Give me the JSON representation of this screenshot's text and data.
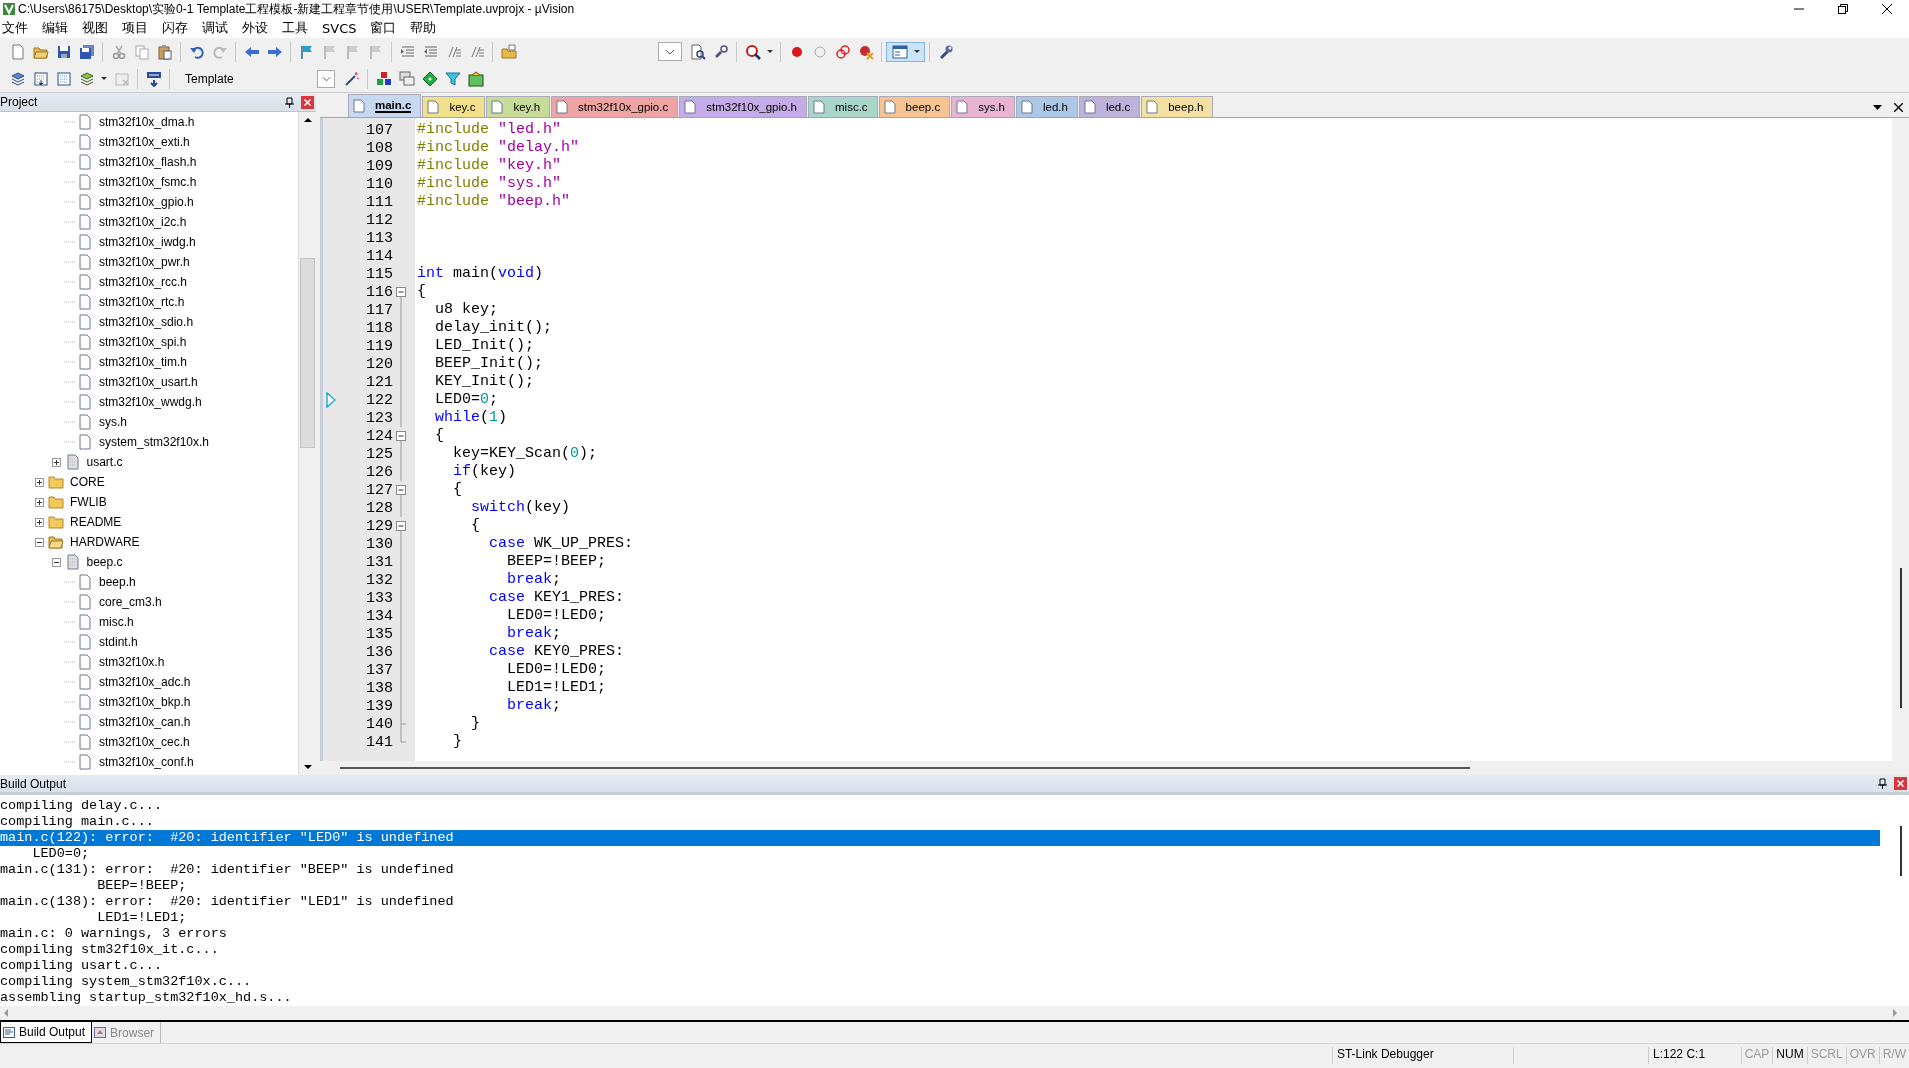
{
  "window": {
    "title": "C:\\Users\\86175\\Desktop\\实验0-1 Template工程模板-新建工程章节使用\\USER\\Template.uvprojx - µVision"
  },
  "menu": [
    "文件",
    "编辑",
    "视图",
    "项目",
    "闪存",
    "调试",
    "外设",
    "工具",
    "SVCS",
    "窗口",
    "帮助"
  ],
  "target_select": {
    "value": "Template"
  },
  "project_panel": {
    "title": "Project",
    "tree": [
      {
        "children": [
          {
            "children": [
              {
                "label": "stm32f10x_dma.h",
                "kind": "header"
              },
              {
                "label": "stm32f10x_exti.h",
                "kind": "header"
              },
              {
                "label": "stm32f10x_flash.h",
                "kind": "header"
              },
              {
                "label": "stm32f10x_fsmc.h",
                "kind": "header"
              },
              {
                "label": "stm32f10x_gpio.h",
                "kind": "header"
              },
              {
                "label": "stm32f10x_i2c.h",
                "kind": "header"
              },
              {
                "label": "stm32f10x_iwdg.h",
                "kind": "header"
              },
              {
                "label": "stm32f10x_pwr.h",
                "kind": "header"
              },
              {
                "label": "stm32f10x_rcc.h",
                "kind": "header"
              },
              {
                "label": "stm32f10x_rtc.h",
                "kind": "header"
              },
              {
                "label": "stm32f10x_sdio.h",
                "kind": "header"
              },
              {
                "label": "stm32f10x_spi.h",
                "kind": "header"
              },
              {
                "label": "stm32f10x_tim.h",
                "kind": "header"
              },
              {
                "label": "stm32f10x_usart.h",
                "kind": "header"
              },
              {
                "label": "stm32f10x_wwdg.h",
                "kind": "header"
              },
              {
                "label": "sys.h",
                "kind": "header"
              },
              {
                "label": "system_stm32f10x.h",
                "kind": "header"
              }
            ]
          },
          {
            "label": "usart.c",
            "kind": "source",
            "expanded": false
          }
        ]
      },
      {
        "label": "CORE",
        "kind": "folder",
        "expanded": false
      },
      {
        "label": "FWLIB",
        "kind": "folder",
        "expanded": false
      },
      {
        "label": "README",
        "kind": "folder",
        "expanded": false
      },
      {
        "label": "HARDWARE",
        "kind": "folder",
        "expanded": true,
        "children": [
          {
            "label": "beep.c",
            "kind": "source",
            "expanded": true,
            "children": [
              {
                "label": "beep.h",
                "kind": "header"
              },
              {
                "label": "core_cm3.h",
                "kind": "header"
              },
              {
                "label": "misc.h",
                "kind": "header"
              },
              {
                "label": "stdint.h",
                "kind": "header"
              },
              {
                "label": "stm32f10x.h",
                "kind": "header"
              },
              {
                "label": "stm32f10x_adc.h",
                "kind": "header"
              },
              {
                "label": "stm32f10x_bkp.h",
                "kind": "header"
              },
              {
                "label": "stm32f10x_can.h",
                "kind": "header"
              },
              {
                "label": "stm32f10x_cec.h",
                "kind": "header"
              },
              {
                "label": "stm32f10x_conf.h",
                "kind": "header"
              }
            ]
          }
        ]
      }
    ]
  },
  "editor_tabs": [
    {
      "label": "main.c",
      "selected": true,
      "color": "#c8d8f0"
    },
    {
      "label": "key.c",
      "selected": false,
      "color": "#f2e08a"
    },
    {
      "label": "key.h",
      "selected": false,
      "color": "#c6dc98"
    },
    {
      "label": "stm32f10x_gpio.c",
      "selected": false,
      "color": "#eea4a4"
    },
    {
      "label": "stm32f10x_gpio.h",
      "selected": false,
      "color": "#c4ace8"
    },
    {
      "label": "misc.c",
      "selected": false,
      "color": "#a8d6c8"
    },
    {
      "label": "beep.c",
      "selected": false,
      "color": "#f5c492"
    },
    {
      "label": "sys.h",
      "selected": false,
      "color": "#e8b4d2"
    },
    {
      "label": "led.h",
      "selected": false,
      "color": "#acc8e6"
    },
    {
      "label": "led.c",
      "selected": false,
      "color": "#bcb2da"
    },
    {
      "label": "beep.h",
      "selected": false,
      "color": "#f5e0a4"
    }
  ],
  "code": [
    {
      "number": "107",
      "kind": "plain",
      "marker": false,
      "segments": [
        {
          "kind": "preproc",
          "text": "#include"
        },
        {
          "kind": "string",
          "text": " \"led.h\""
        }
      ]
    },
    {
      "number": "108",
      "kind": "plain",
      "marker": false,
      "segments": [
        {
          "kind": "preproc",
          "text": "#include"
        },
        {
          "kind": "string",
          "text": " \"delay.h\""
        }
      ]
    },
    {
      "number": "109",
      "kind": "plain",
      "marker": false,
      "segments": [
        {
          "kind": "preproc",
          "text": "#include"
        },
        {
          "kind": "string",
          "text": " \"key.h\""
        }
      ]
    },
    {
      "number": "110",
      "kind": "plain",
      "marker": false,
      "segments": [
        {
          "kind": "preproc",
          "text": "#include"
        },
        {
          "kind": "string",
          "text": " \"sys.h\""
        }
      ]
    },
    {
      "number": "111",
      "kind": "plain",
      "marker": false,
      "segments": [
        {
          "kind": "preproc",
          "text": "#include"
        },
        {
          "kind": "string",
          "text": " \"beep.h\""
        }
      ]
    },
    {
      "number": "112",
      "kind": "plain",
      "marker": false
    },
    {
      "number": "113",
      "kind": "plain",
      "marker": false
    },
    {
      "number": "114",
      "kind": "plain",
      "marker": false
    },
    {
      "number": "115",
      "kind": "plain",
      "marker": false,
      "segments": [
        {
          "kind": "keyword",
          "text": "int"
        },
        {
          "kind": "plain",
          "text": " main("
        },
        {
          "kind": "keyword",
          "text": "void"
        },
        {
          "kind": "plain",
          "text": ")"
        }
      ]
    },
    {
      "number": "116",
      "kind": "fold_start",
      "marker": false,
      "segments": [
        {
          "kind": "plain",
          "text": "{"
        }
      ]
    },
    {
      "number": "117",
      "kind": "fold_body",
      "marker": false,
      "segments": [
        {
          "kind": "plain",
          "text": "  u8 key;"
        }
      ]
    },
    {
      "number": "118",
      "kind": "fold_body",
      "marker": false,
      "segments": [
        {
          "kind": "plain",
          "text": "  delay_init();"
        }
      ]
    },
    {
      "number": "119",
      "kind": "fold_body",
      "marker": false,
      "segments": [
        {
          "kind": "plain",
          "text": "  LED_Init();"
        }
      ]
    },
    {
      "number": "120",
      "kind": "fold_body",
      "marker": false,
      "segments": [
        {
          "kind": "plain",
          "text": "  BEEP_Init();"
        }
      ]
    },
    {
      "number": "121",
      "kind": "fold_body",
      "marker": false,
      "segments": [
        {
          "kind": "plain",
          "text": "  KEY_Init();"
        }
      ]
    },
    {
      "number": "122",
      "kind": "fold_body",
      "marker": true,
      "segments": [
        {
          "kind": "plain",
          "text": "  LED0="
        },
        {
          "kind": "number",
          "text": "0"
        },
        {
          "kind": "plain",
          "text": ";"
        }
      ]
    },
    {
      "number": "123",
      "kind": "fold_body",
      "marker": false,
      "segments": [
        {
          "kind": "keyword",
          "text": "  while"
        },
        {
          "kind": "plain",
          "text": "("
        },
        {
          "kind": "number",
          "text": "1"
        },
        {
          "kind": "plain",
          "text": ")"
        }
      ]
    },
    {
      "number": "124",
      "kind": "fold_start",
      "marker": false,
      "segments": [
        {
          "kind": "plain",
          "text": "  {"
        }
      ]
    },
    {
      "number": "125",
      "kind": "fold_body",
      "marker": false,
      "segments": [
        {
          "kind": "plain",
          "text": "    key=KEY_Scan("
        },
        {
          "kind": "number",
          "text": "0"
        },
        {
          "kind": "plain",
          "text": ");"
        }
      ]
    },
    {
      "number": "126",
      "kind": "fold_body",
      "marker": false,
      "segments": [
        {
          "kind": "keyword",
          "text": "    if"
        },
        {
          "kind": "plain",
          "text": "(key)"
        }
      ]
    },
    {
      "number": "127",
      "kind": "fold_start",
      "marker": false,
      "segments": [
        {
          "kind": "plain",
          "text": "    {"
        }
      ]
    },
    {
      "number": "128",
      "kind": "fold_body",
      "marker": false,
      "segments": [
        {
          "kind": "keyword",
          "text": "      switch"
        },
        {
          "kind": "plain",
          "text": "(key)"
        }
      ]
    },
    {
      "number": "129",
      "kind": "fold_start",
      "marker": false,
      "segments": [
        {
          "kind": "plain",
          "text": "      {"
        }
      ]
    },
    {
      "number": "130",
      "kind": "fold_body",
      "marker": false,
      "segments": [
        {
          "kind": "keyword",
          "text": "        case"
        },
        {
          "kind": "plain",
          "text": " WK_UP_PRES:"
        }
      ]
    },
    {
      "number": "131",
      "kind": "fold_body",
      "marker": false,
      "segments": [
        {
          "kind": "plain",
          "text": "          BEEP=!BEEP;"
        }
      ]
    },
    {
      "number": "132",
      "kind": "fold_body",
      "marker": false,
      "segments": [
        {
          "kind": "keyword",
          "text": "          break"
        },
        {
          "kind": "plain",
          "text": ";"
        }
      ]
    },
    {
      "number": "133",
      "kind": "fold_body",
      "marker": false,
      "segments": [
        {
          "kind": "keyword",
          "text": "        case"
        },
        {
          "kind": "plain",
          "text": " KEY1_PRES:"
        }
      ]
    },
    {
      "number": "134",
      "kind": "fold_body",
      "marker": false,
      "segments": [
        {
          "kind": "plain",
          "text": "          LED0=!LED0;"
        }
      ]
    },
    {
      "number": "135",
      "kind": "fold_body",
      "marker": false,
      "segments": [
        {
          "kind": "keyword",
          "text": "          break"
        },
        {
          "kind": "plain",
          "text": ";"
        }
      ]
    },
    {
      "number": "136",
      "kind": "fold_body",
      "marker": false,
      "segments": [
        {
          "kind": "keyword",
          "text": "        case"
        },
        {
          "kind": "plain",
          "text": " KEY0_PRES:"
        }
      ]
    },
    {
      "number": "137",
      "kind": "fold_body",
      "marker": false,
      "segments": [
        {
          "kind": "plain",
          "text": "          LED0=!LED0;"
        }
      ]
    },
    {
      "number": "138",
      "kind": "fold_body",
      "marker": false,
      "segments": [
        {
          "kind": "plain",
          "text": "          LED1=!LED1;"
        }
      ]
    },
    {
      "number": "139",
      "kind": "fold_body",
      "marker": false,
      "segments": [
        {
          "kind": "keyword",
          "text": "          break"
        },
        {
          "kind": "plain",
          "text": ";"
        }
      ]
    },
    {
      "number": "140",
      "kind": "fold_end",
      "marker": false,
      "segments": [
        {
          "kind": "plain",
          "text": "      }"
        }
      ]
    },
    {
      "number": "141",
      "kind": "fold_end",
      "marker": false,
      "segments": [
        {
          "kind": "plain",
          "text": "    }"
        }
      ]
    }
  ],
  "build_output": {
    "title": "Build Output",
    "lines": [
      {
        "text": "compiling delay.c...",
        "selected": false
      },
      {
        "text": "compiling main.c...",
        "selected": false
      },
      {
        "text": "main.c(122): error:  #20: identifier \"LED0\" is undefined",
        "selected": true
      },
      {
        "text": "    LED0=0;",
        "selected": false
      },
      {
        "text": "main.c(131): error:  #20: identifier \"BEEP\" is undefined",
        "selected": false
      },
      {
        "text": "            BEEP=!BEEP;",
        "selected": false
      },
      {
        "text": "main.c(138): error:  #20: identifier \"LED1\" is undefined",
        "selected": false
      },
      {
        "text": "            LED1=!LED1;",
        "selected": false
      },
      {
        "text": "main.c: 0 warnings, 3 errors",
        "selected": false
      },
      {
        "text": "compiling stm32f10x_it.c...",
        "selected": false
      },
      {
        "text": "compiling usart.c...",
        "selected": false
      },
      {
        "text": "compiling system_stm32f10x.c...",
        "selected": false
      },
      {
        "text": "assembling startup_stm32f10x_hd.s...",
        "selected": false
      }
    ],
    "tabs": [
      {
        "label": "Build Output",
        "selected": true
      },
      {
        "label": "Browser",
        "selected": false
      }
    ]
  },
  "status_bar": {
    "debugger": "ST-Link Debugger",
    "position": "L:122 C:1",
    "indicators": [
      {
        "label": "CAP",
        "on": false
      },
      {
        "label": "NUM",
        "on": true
      },
      {
        "label": "SCRL",
        "on": false
      },
      {
        "label": "OVR",
        "on": false
      },
      {
        "label": "R/W",
        "on": false
      }
    ]
  }
}
